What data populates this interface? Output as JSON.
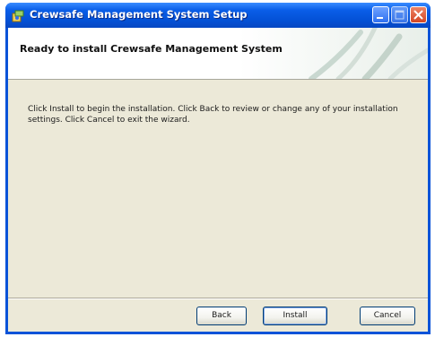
{
  "window": {
    "title": "Crewsafe Management System Setup"
  },
  "banner": {
    "title": "Ready to install Crewsafe Management System"
  },
  "content": {
    "instructions": "Click Install to begin the installation. Click Back to review or change any of your installation settings. Click Cancel to exit the wizard."
  },
  "buttons": {
    "back": "Back",
    "install": "Install",
    "cancel": "Cancel"
  },
  "icons": {
    "app": "installer-icon",
    "minimize": "minimize-icon",
    "maximize": "maximize-icon",
    "close": "close-icon"
  },
  "colors": {
    "titlebar": "#0a5ee8",
    "client_background": "#ece9d8",
    "banner_background": "#ffffff",
    "close_button": "#d44624"
  }
}
